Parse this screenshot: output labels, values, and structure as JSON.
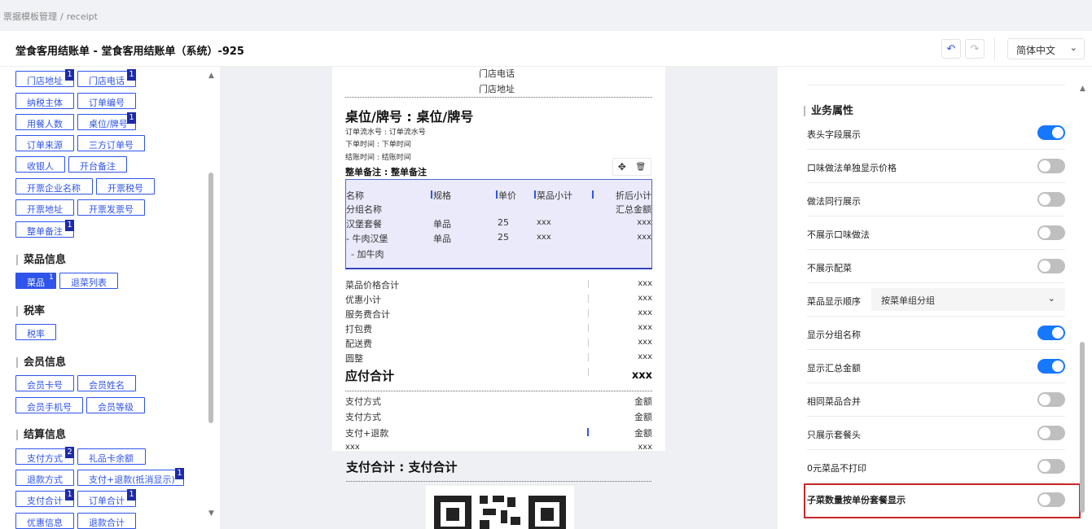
{
  "breadcrumb": {
    "parent": "票据模板管理",
    "sep": "/",
    "current": "receipt"
  },
  "header": {
    "title": "堂食客用结账单 - 堂食客用结账单（系统）-925",
    "undo_icon": "undo-icon",
    "redo_icon": "redo-icon",
    "language": "简体中文"
  },
  "colors": {
    "accent": "#2f54eb",
    "toggle_on": "#1677ff",
    "highlight": "#c62828"
  },
  "fields": {
    "store_phone": "门店电话",
    "store_address": "门店地址",
    "taxpayer": "纳税主体",
    "order_no": "订单编号",
    "diners": "用餐人数",
    "table_no": "桌位/牌号",
    "order_source": "订单来源",
    "third_order_no": "三方订单号",
    "cashier": "收银人",
    "open_remark": "开台备注",
    "invoice_company": "开票企业名称",
    "invoice_tax": "开票税号",
    "invoice_address": "开票地址",
    "invoice_no": "开票发票号",
    "order_remark": "整单备注",
    "dish_section": "菜品信息",
    "dish": "菜品",
    "refund_list": "退菜列表",
    "tax_section": "税率",
    "tax_rate": "税率",
    "member_section": "会员信息",
    "member_card": "会员卡号",
    "member_name": "会员姓名",
    "member_phone": "会员手机号",
    "member_level": "会员等级",
    "settle_section": "结算信息",
    "pay_method": "支付方式",
    "gift_balance": "礼品卡余额",
    "refund_method": "退款方式",
    "pay_refund": "支付+退款(抵消显示)",
    "pay_total": "支付合计",
    "order_total": "订单合计",
    "discount_info": "优惠信息",
    "refund_total": "退款合计",
    "badges": {
      "one": "1",
      "two": "2"
    }
  },
  "receipt": {
    "store_phone": "门店电话",
    "store_address": "门店地址",
    "table_line": "桌位/牌号 : 桌位/牌号",
    "serial": "订单流水号 : 订单流水号",
    "order_time": "下单时间 : 下单时间",
    "checkout_time": "结账时间 : 结账时间",
    "remark": "整单备注 : 整单备注",
    "tool_move": "✥",
    "tool_delete": "🗑",
    "col_name": "名称",
    "col_spec": "规格",
    "col_price": "单价",
    "col_subtotal": "菜品小计",
    "col_after": "折后小计",
    "group_name": "分组名称",
    "group_total": "汇总金额",
    "item1_name": "汉堡套餐",
    "item1_spec": "单品",
    "item1_price": "25",
    "item1_sub": "xxx",
    "item1_after": "xxx",
    "item2_name": "- 牛肉汉堡",
    "item2_spec": "单品",
    "item2_price": "25",
    "item2_sub": "xxx",
    "item2_after": "xxx",
    "item3_name": "- 加牛肉",
    "sum_labels": [
      "菜品价格合计",
      "优惠小计",
      "服务费合计",
      "打包费",
      "配送费",
      "圆整"
    ],
    "sum_values": [
      "xxx",
      "xxx",
      "xxx",
      "xxx",
      "xxx",
      "xxx"
    ],
    "payable_label": "应付合计",
    "payable_value": "xxx",
    "pay1_label": "支付方式",
    "pay1_value": "金额",
    "pay2_label": "支付方式",
    "pay2_value": "金额",
    "pay3_label": "支付+退款",
    "pay3_value": "金额",
    "pay4_label": "xxx",
    "pay4_value": "xxx",
    "pay_total": "支付合计 : 支付合计"
  },
  "props": {
    "section": "业务属性",
    "row1": "表头字段展示",
    "row2": "口味做法单独显示价格",
    "row3": "做法同行展示",
    "row4": "不展示口味做法",
    "row5": "不展示配菜",
    "row6": "菜品显示顺序",
    "row6_value": "按菜单组分组",
    "row7": "显示分组名称",
    "row8": "显示汇总金额",
    "row9": "相同菜品合并",
    "row10": "只展示套餐头",
    "row11": "0元菜品不打印",
    "row12": "子菜数量按单份套餐显示",
    "toggles": [
      true,
      false,
      false,
      false,
      false,
      true,
      true,
      false,
      false,
      false,
      false
    ]
  }
}
